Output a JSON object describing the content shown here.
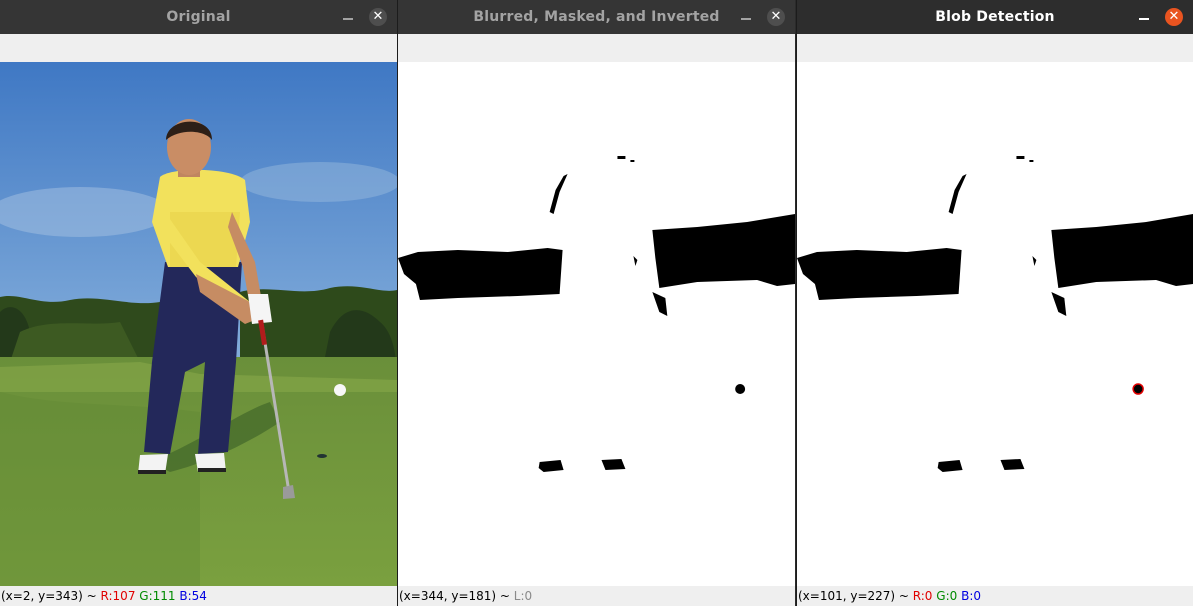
{
  "colors": {
    "accent_close": "#e95420",
    "red": "#e00000",
    "green": "#008a00",
    "blue": "#0000e0"
  },
  "windows": [
    {
      "title": "Original",
      "active": false,
      "status": {
        "coords": "(x=2, y=343) ~ ",
        "r": "R:107",
        "g": "G:111",
        "b": "B:54"
      }
    },
    {
      "title": "Blurred, Masked, and Inverted",
      "active": false,
      "status": {
        "coords": "(x=344, y=181) ~ ",
        "l": "L:0"
      }
    },
    {
      "title": "Blob Detection",
      "active": true,
      "status": {
        "coords": "(x=101, y=227) ~ ",
        "r": "R:0",
        "g": "G:0",
        "b": "B:0"
      }
    }
  ],
  "icons": {
    "minimize": "minimize-icon",
    "close": "close-icon",
    "close_glyph": "✕"
  }
}
